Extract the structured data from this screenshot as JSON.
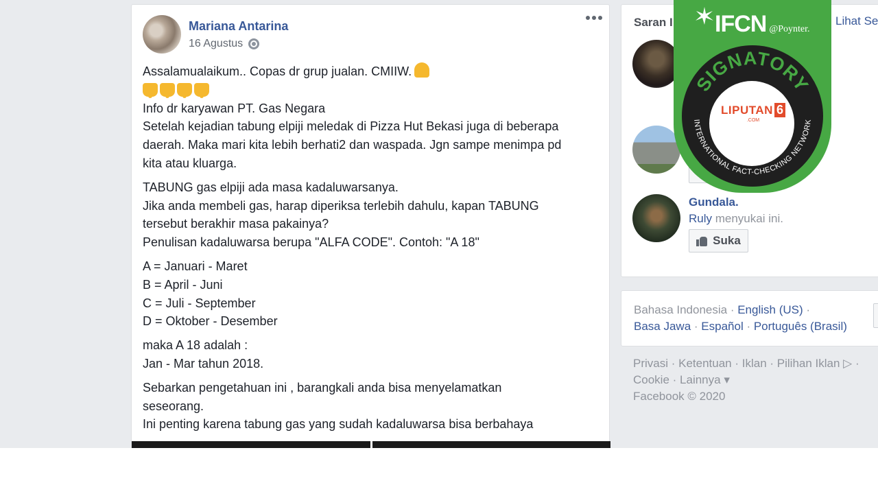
{
  "post": {
    "author": "Mariana Antarina",
    "date": "16 Agustus",
    "lines": [
      "Assalamualaikum.. Copas dr grup jualan. CMIIW.",
      "Info dr karyawan PT. Gas Negara",
      "Setelah kejadian tabung elpiji meledak di Pizza Hut Bekasi juga di beberapa",
      "daerah. Maka mari kita lebih berhati2 dan waspada. Jgn sampe menimpa pd",
      "kita atau kluarga.",
      "TABUNG gas elpiji ada masa kadaluwarsanya.",
      "Jika anda membeli gas, harap diperiksa terlebih dahulu, kapan TABUNG",
      "tersebut berakhir masa pakainya?",
      "Penulisan kadaluwarsa berupa \"ALFA CODE\". Contoh: \"A 18\"",
      "A = Januari - Maret",
      "B = April - Juni",
      "C = Juli - September",
      "D = Oktober - Desember",
      "maka A 18 adalah :",
      "Jan - Mar tahun 2018.",
      "Sebarkan pengetahuan ini , barangkali anda bisa menyelamatkan",
      "seseorang.",
      "Ini penting karena tabung gas yang sudah kadaluwarsa bisa berbahaya"
    ]
  },
  "sidebar": {
    "title": "Saran I",
    "see_all": "Lihat Se",
    "suggestion": {
      "name": "Gundala.",
      "friend": "Ruly",
      "activity": " menyukai ini.",
      "like_label": "Suka"
    }
  },
  "languages": {
    "current": "Bahasa Indonesia",
    "others": [
      "English (US)",
      "Basa Jawa",
      "Español",
      "Português (Brasil)"
    ]
  },
  "footer": {
    "links": [
      "Privasi",
      "Ketentuan",
      "Iklan",
      "Pilihan Iklan",
      "Cookie",
      "Lainnya"
    ],
    "copyright": "Facebook © 2020"
  },
  "badge": {
    "title": "IFCN",
    "poynter": "@Poynter.",
    "ring_top": "SIGNATORY",
    "ring_bottom": "INTERNATIONAL FACT-CHECKING NETWORK",
    "liputan_word": "LIPUTAN",
    "liputan_num": "6",
    "liputan_com": ".COM"
  },
  "colors": {
    "link": "#385898",
    "badge_green": "#47a844"
  }
}
